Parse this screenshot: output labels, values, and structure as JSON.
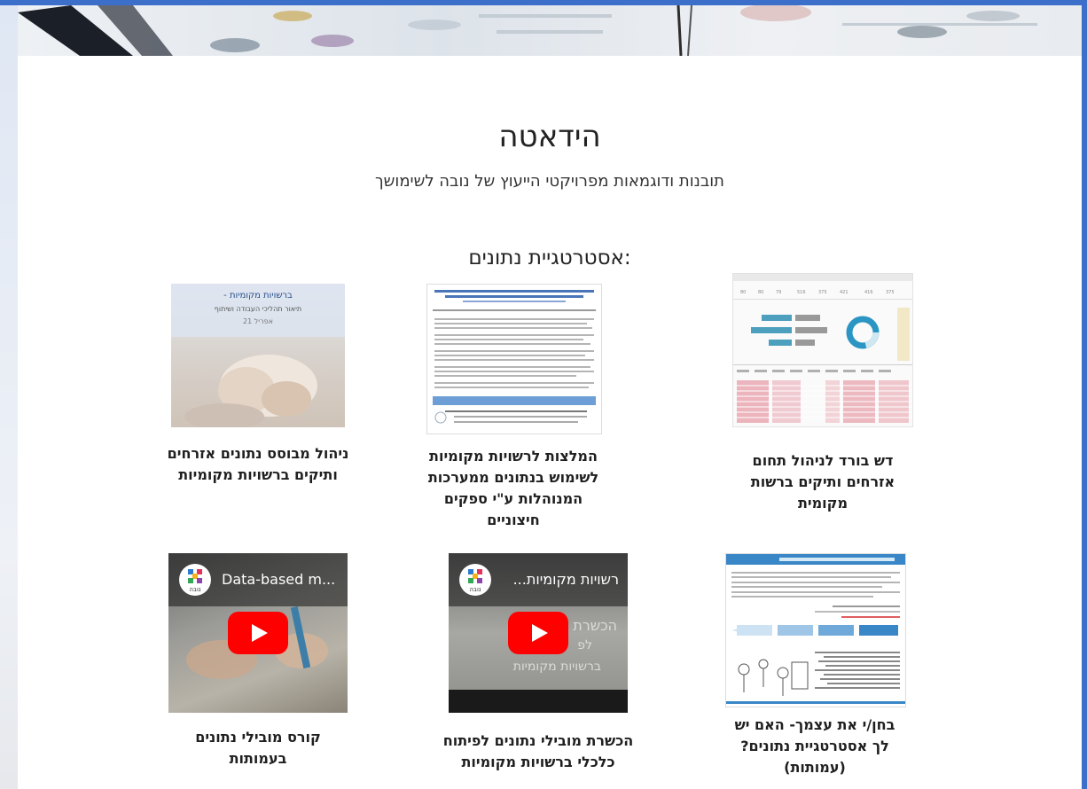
{
  "page": {
    "title": "הידאטה",
    "subtitle": "תובנות ודוגמאות מפרויקטי הייעוץ של נובה לשימושך",
    "section_title": "אסטרטגיית נתונים:"
  },
  "cards": [
    {
      "caption": "ניהול מבוסס נתונים אזרחים ותיקים ברשויות מקומיות",
      "thumb_lines": [
        "ברשויות מקומיות -",
        "תיאור תהליכי העבודה ושיתוף",
        "אפריל 21"
      ]
    },
    {
      "caption": "המלצות לרשויות מקומיות לשימוש בנתונים ממערכות המנוהלות ע\"י ספקים חיצוניים"
    },
    {
      "caption": "דש בורד לניהול תחום אזרחים ותיקים ברשות מקומית"
    },
    {
      "caption": "קורס מובילי נתונים בעמותות",
      "video_title": "Data-based m...",
      "logo_text": "נובה"
    },
    {
      "caption": "הכשרת מובילי נתונים לפיתוח כלכלי ברשויות מקומיות",
      "video_title": "רשויות מקומיות...",
      "logo_text": "נובה",
      "overlay_lines": [
        "הכשרת",
        "לפ",
        "ברשויות מקומיות"
      ]
    },
    {
      "caption": "בחן/י את עצמך- האם יש לך אסטרטגיית נתונים? (עמותות)"
    }
  ],
  "colors": {
    "accent": "#3b6fc9",
    "play": "#ff0000"
  }
}
